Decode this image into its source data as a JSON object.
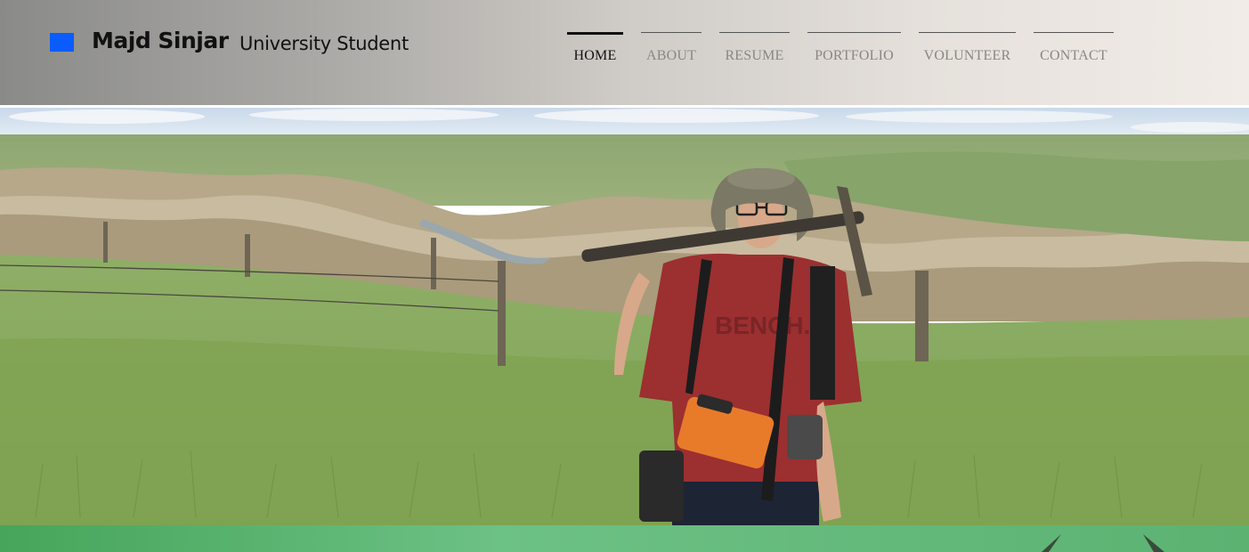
{
  "header": {
    "name": "Majd Sinjar",
    "role": "University Student",
    "logo_color": "#0a5cff"
  },
  "nav": {
    "items": [
      {
        "label": "HOME",
        "active": true
      },
      {
        "label": "ABOUT",
        "active": false
      },
      {
        "label": "RESUME",
        "active": false
      },
      {
        "label": "PORTFOLIO",
        "active": false
      },
      {
        "label": "VOLUNTEER",
        "active": false
      },
      {
        "label": "CONTACT",
        "active": false
      }
    ]
  },
  "hero": {
    "shirt_text": "BENCH."
  },
  "colors": {
    "band": "#5bb271",
    "active_nav": "#111111",
    "inactive_nav": "#8b8682"
  }
}
